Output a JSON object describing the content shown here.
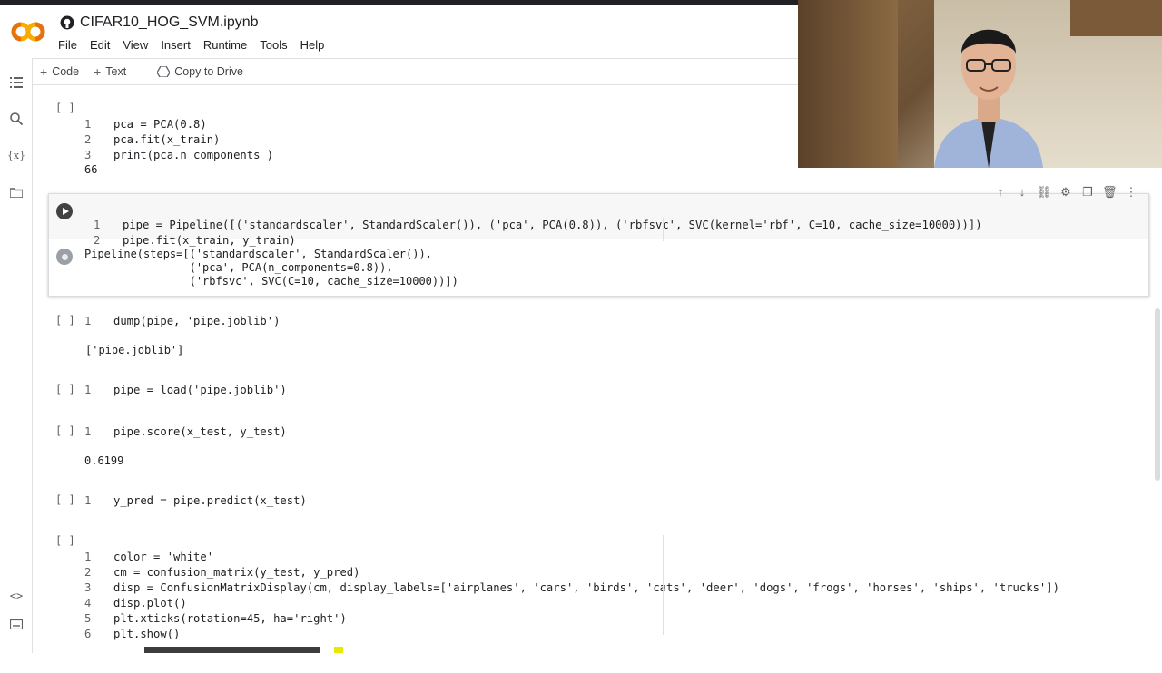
{
  "header": {
    "logo_text": "CO",
    "title": "CIFAR10_HOG_SVM.ipynb",
    "menu": [
      "File",
      "Edit",
      "View",
      "Insert",
      "Runtime",
      "Tools",
      "Help"
    ]
  },
  "toolbar": {
    "code_label": "Code",
    "text_label": "Text",
    "copy_label": "Copy to Drive"
  },
  "sidebar_icons": [
    "toc-icon",
    "search-icon",
    "variables-icon",
    "files-icon",
    "code-snippets-icon",
    "terminal-icon"
  ],
  "cells": [
    {
      "bracket": "[ ]",
      "lines": [
        "pca = PCA(0.8)",
        "pca.fit(x_train)",
        "print(pca.n_components_)"
      ],
      "output": "66"
    },
    {
      "bracket": "",
      "lines": [
        "pipe = Pipeline([('standardscaler', StandardScaler()), ('pca', PCA(0.8)), ('rbfsvc', SVC(kernel='rbf', C=10, cache_size=10000))])",
        "pipe.fit(x_train, y_train)"
      ],
      "output": "Pipeline(steps=[('standardscaler', StandardScaler()),\n                ('pca', PCA(n_components=0.8)),\n                ('rbfsvc', SVC(C=10, cache_size=10000))])"
    },
    {
      "bracket": "[ ]",
      "lines": [
        "dump(pipe, 'pipe.joblib')"
      ],
      "output": "['pipe.joblib']"
    },
    {
      "bracket": "[ ]",
      "lines": [
        "pipe = load('pipe.joblib')"
      ],
      "output": ""
    },
    {
      "bracket": "[ ]",
      "lines": [
        "pipe.score(x_test, y_test)"
      ],
      "output": "0.6199"
    },
    {
      "bracket": "[ ]",
      "lines": [
        "y_pred = pipe.predict(x_test)"
      ],
      "output": ""
    },
    {
      "bracket": "[ ]",
      "lines": [
        "color = 'white'",
        "cm = confusion_matrix(y_test, y_pred)",
        "disp = ConfusionMatrixDisplay(cm, display_labels=['airplanes', 'cars', 'birds', 'cats', 'deer', 'dogs', 'frogs', 'horses', 'ships', 'trucks'])",
        "disp.plot()",
        "plt.xticks(rotation=45, ha='right')",
        "plt.show()"
      ],
      "output": ""
    }
  ],
  "line_numbers": [
    "1",
    "2",
    "3",
    "4",
    "5",
    "6"
  ]
}
